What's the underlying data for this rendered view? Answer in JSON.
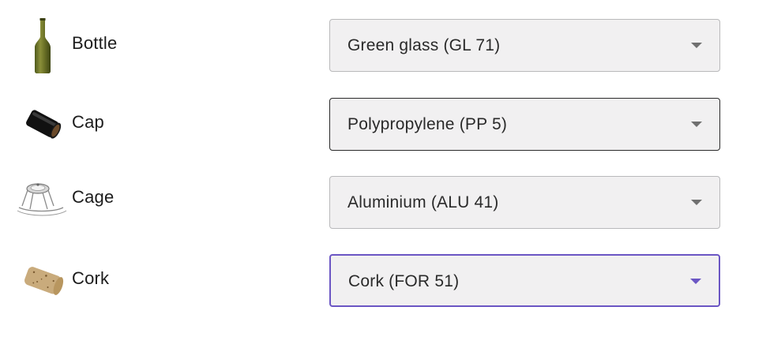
{
  "components": [
    {
      "key": "bottle",
      "label": "Bottle",
      "icon": "green-wine-bottle-icon",
      "selected": "Green glass (GL 71)",
      "state": "default"
    },
    {
      "key": "cap",
      "label": "Cap",
      "icon": "black-capsule-icon",
      "selected": "Polypropylene (PP 5)",
      "state": "hover"
    },
    {
      "key": "cage",
      "label": "Cage",
      "icon": "wire-cage-icon",
      "selected": "Aluminium (ALU 41)",
      "state": "default"
    },
    {
      "key": "cork",
      "label": "Cork",
      "icon": "cork-stopper-icon",
      "selected": "Cork (FOR 51)",
      "state": "focused"
    }
  ],
  "colors": {
    "select_background": "#f1f0f1",
    "select_border": "#b9b9bb",
    "hover_border": "#2a2a2a",
    "focus_accent": "#6b56c4",
    "caret": "#707070"
  }
}
